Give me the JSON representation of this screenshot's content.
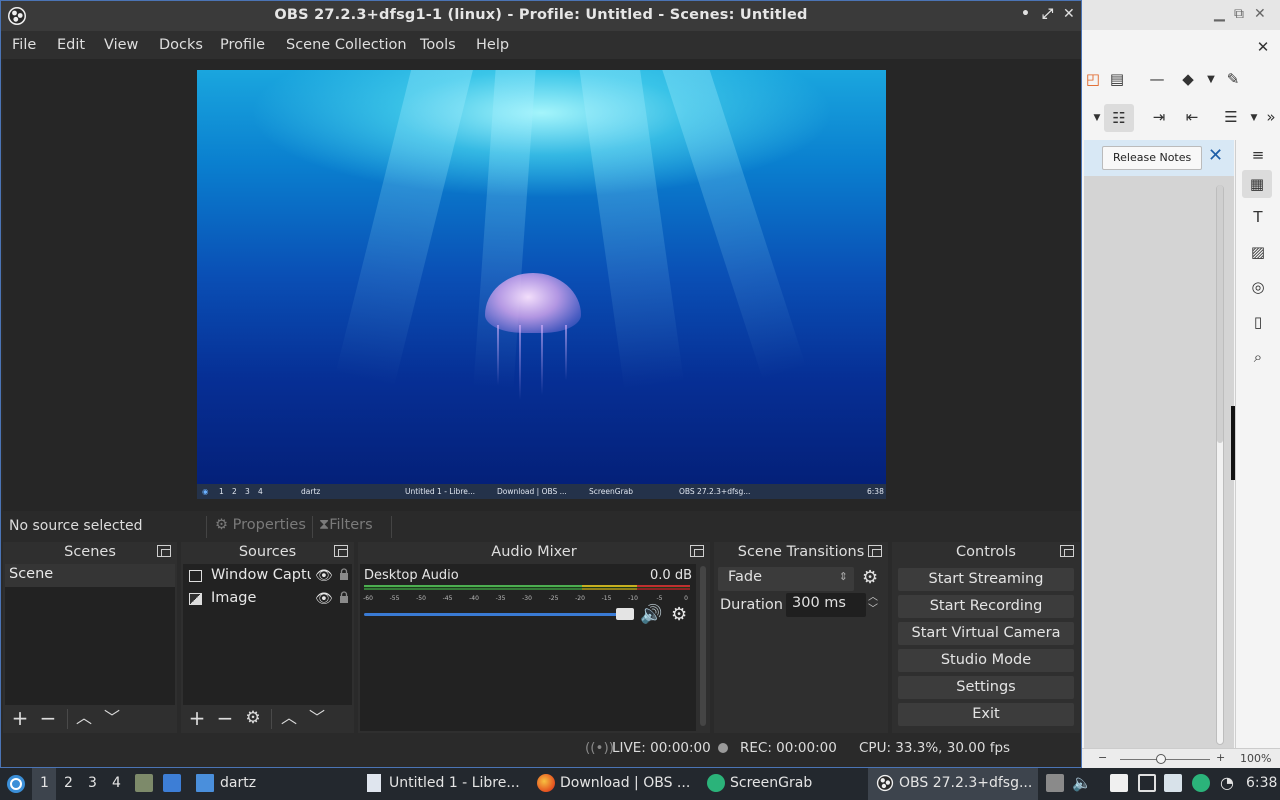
{
  "obs": {
    "title": "OBS 27.2.3+dfsg1-1 (linux) - Profile: Untitled - Scenes: Untitled",
    "window_buttons": [
      "•",
      "⤢",
      "✕"
    ],
    "menu": [
      "File",
      "Edit",
      "View",
      "Docks",
      "Profile",
      "Scene Collection",
      "Tools",
      "Help"
    ],
    "preview_taskbar": {
      "workspaces": [
        "1",
        "2",
        "3",
        "4"
      ],
      "user": "dartz",
      "items": [
        "Untitled 1 - Libre...",
        "Download | OBS ...",
        "ScreenGrab",
        "OBS 27.2.3+dfsg..."
      ],
      "clock": "6:38"
    },
    "source_toolbar": {
      "no_source": "No source selected",
      "properties": "Properties",
      "filters": "Filters"
    },
    "docks": {
      "scenes": {
        "title": "Scenes",
        "items": [
          "Scene"
        ]
      },
      "sources": {
        "title": "Sources",
        "items": [
          {
            "name": "Window Captu",
            "icon": "window-icon"
          },
          {
            "name": "Image",
            "icon": "image-icon"
          }
        ]
      },
      "mixer": {
        "title": "Audio Mixer",
        "channel": "Desktop Audio",
        "level": "0.0 dB",
        "ticks": [
          "-60",
          "-55",
          "-50",
          "-45",
          "-40",
          "-35",
          "-30",
          "-25",
          "-20",
          "-15",
          "-10",
          "-5",
          "0"
        ],
        "volume_fraction": 1.0
      },
      "transitions": {
        "title": "Scene Transitions",
        "selected": "Fade",
        "duration_label": "Duration",
        "duration_value": "300 ms"
      },
      "controls": {
        "title": "Controls",
        "buttons": [
          "Start Streaming",
          "Start Recording",
          "Start Virtual Camera",
          "Studio Mode",
          "Settings",
          "Exit"
        ]
      }
    },
    "status": {
      "live": "LIVE: 00:00:00",
      "rec": "REC: 00:00:00",
      "cpu": "CPU: 33.3%, 30.00 fps"
    }
  },
  "libreoffice": {
    "release_notes": "Release Notes",
    "zoom": "100%"
  },
  "taskbar": {
    "workspaces": [
      "1",
      "2",
      "3",
      "4"
    ],
    "user": "dartz",
    "items": [
      "Untitled 1 - Libre...",
      "Download | OBS ...",
      "ScreenGrab",
      "OBS 27.2.3+dfsg..."
    ],
    "clock": "6:38"
  },
  "colors": {
    "obs_bg": "#2a2a2a",
    "accent": "#3a7bd5",
    "meter_green": "#4caf50",
    "meter_yellow": "#c8b020",
    "meter_red": "#c03030"
  }
}
